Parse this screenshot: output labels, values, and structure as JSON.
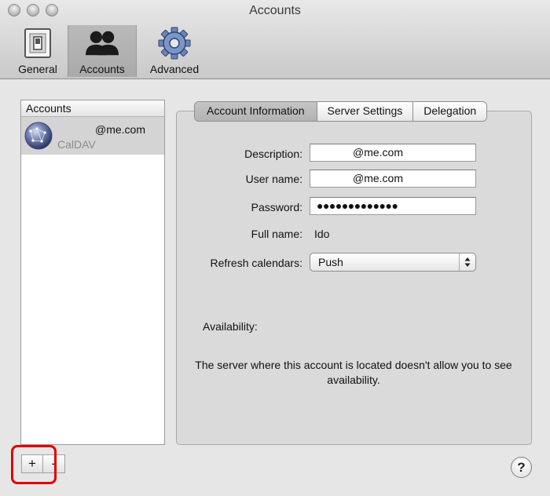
{
  "window": {
    "title": "Accounts"
  },
  "toolbar": {
    "items": [
      {
        "label": "General",
        "icon": "general-switch-icon",
        "selected": false
      },
      {
        "label": "Accounts",
        "icon": "accounts-people-icon",
        "selected": true
      },
      {
        "label": "Advanced",
        "icon": "advanced-gear-icon",
        "selected": false
      }
    ]
  },
  "sidebar": {
    "header": "Accounts",
    "accounts": [
      {
        "email": "@me.com",
        "type": "CalDAV",
        "icon": "globe-icon"
      }
    ],
    "add_label": "+",
    "remove_label": "-"
  },
  "tabs": [
    {
      "label": "Account Information",
      "selected": true
    },
    {
      "label": "Server Settings",
      "selected": false
    },
    {
      "label": "Delegation",
      "selected": false
    }
  ],
  "form": {
    "description_label": "Description:",
    "description_value": "@me.com",
    "username_label": "User name:",
    "username_value": "@me.com",
    "password_label": "Password:",
    "password_value": "●●●●●●●●●●●●●",
    "fullname_label": "Full name:",
    "fullname_value": "Ido",
    "refresh_label": "Refresh calendars:",
    "refresh_value": "Push"
  },
  "availability": {
    "label": "Availability:",
    "message": "The server where this account is located doesn't allow you to see availability."
  },
  "help": {
    "label": "?"
  },
  "colors": {
    "highlight": "#e00000",
    "selection": "#d4d4d4"
  }
}
